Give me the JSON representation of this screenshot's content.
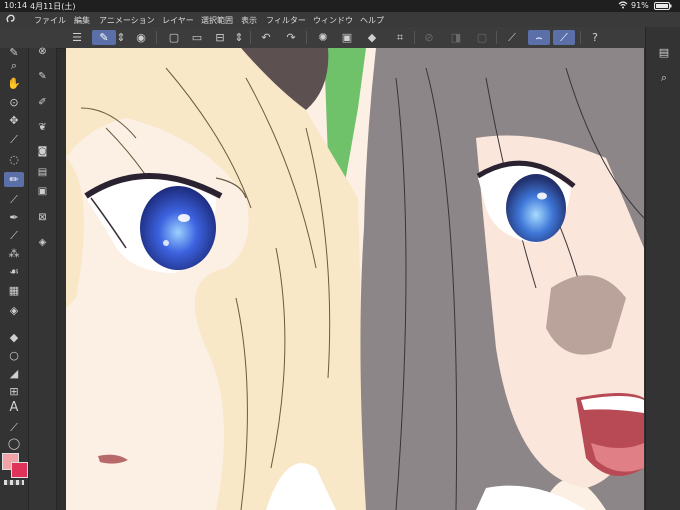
{
  "status": {
    "time": "10:14",
    "date": "4月11日(土)",
    "battery": "91%"
  },
  "menu": {
    "items": [
      "ファイル",
      "編集",
      "アニメーション",
      "レイヤー",
      "選択範囲",
      "表示",
      "フィルター",
      "ウィンドウ",
      "ヘルプ"
    ]
  },
  "icons": {
    "app_logo": "clip-studio-logo-icon",
    "wifi": "wifi-icon",
    "battery": "battery-icon",
    "menu": "hamburger-menu-icon"
  },
  "colors": {
    "main_color": "#f2a3a7",
    "sub_color": "#e0335c",
    "accent": "#5b6fa8",
    "toolbar_bg": "#3c3c3c",
    "canvas_skin": "#fbeee2",
    "hair_blonde": "#f6e7c7",
    "hair_gray": "#8c8587",
    "eye_blue": "#3b5fd8",
    "ribbon_green": "#6fc16a"
  }
}
